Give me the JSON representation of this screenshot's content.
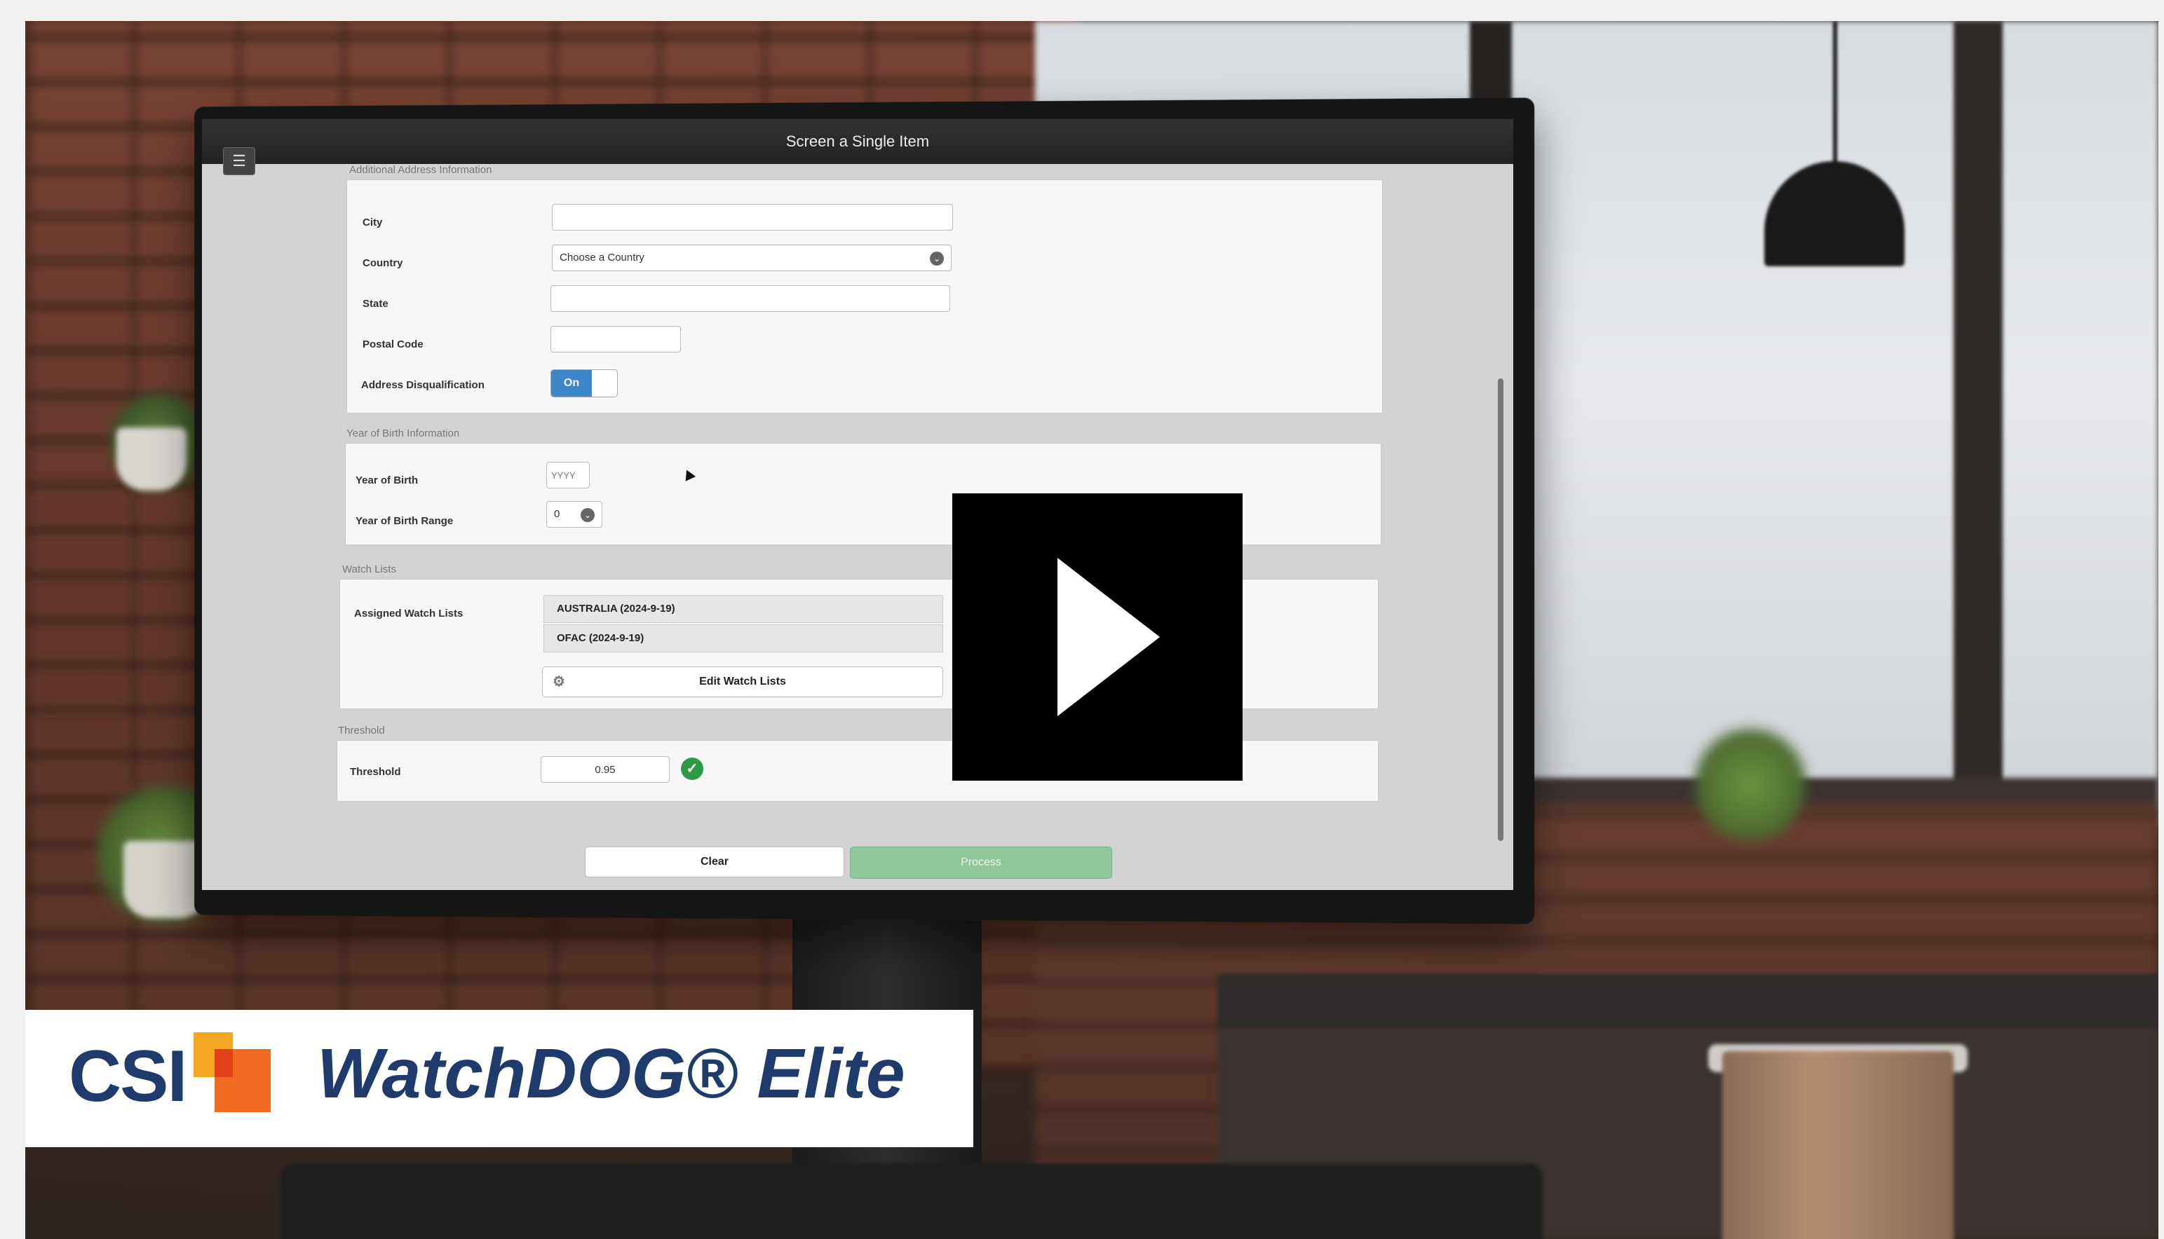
{
  "app": {
    "window_title": "Screen a Single Item",
    "menu_icon": "hamburger-menu-icon"
  },
  "sections": {
    "address": {
      "label": "Additional Address Information",
      "city_label": "City",
      "city_value": "",
      "country_label": "Country",
      "country_value": "Choose a Country",
      "state_label": "State",
      "state_value": "",
      "postal_label": "Postal Code",
      "postal_value": "",
      "disq_label": "Address Disqualification",
      "disq_toggle": "On"
    },
    "yob": {
      "label": "Year of Birth Information",
      "year_label": "Year of Birth",
      "year_placeholder": "YYYY",
      "range_label": "Year of Birth Range",
      "range_value": "0"
    },
    "watch": {
      "label": "Watch Lists",
      "assigned_label": "Assigned Watch Lists",
      "lists": [
        "AUSTRALIA (2024-9-19)",
        "OFAC (2024-9-19)"
      ],
      "edit_button": "Edit Watch Lists"
    },
    "threshold": {
      "label": "Threshold",
      "field_label": "Threshold",
      "value": "0.95"
    }
  },
  "actions": {
    "clear": "Clear",
    "process": "Process"
  },
  "logo": {
    "company": "CSI",
    "product": "WatchDOG® Elite"
  },
  "colors": {
    "toggle_on": "#3d86c9",
    "check_green": "#2f9a44",
    "process_green": "#8fc69a",
    "logo_navy": "#1f3b6b",
    "logo_orange": "#f06b1f"
  }
}
